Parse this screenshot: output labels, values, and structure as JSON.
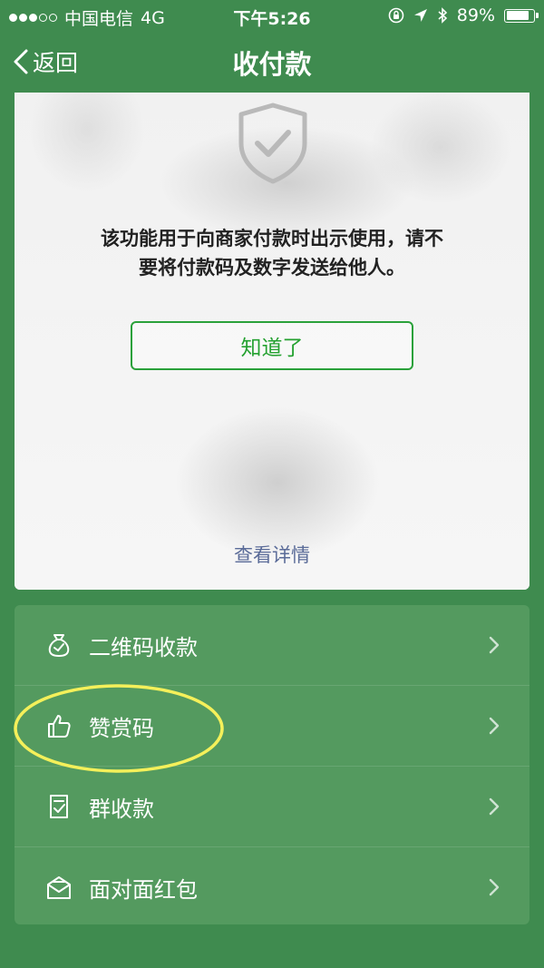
{
  "status_bar": {
    "carrier": "中国电信",
    "network": "4G",
    "time": "下午5:26",
    "battery_percent": "89%",
    "battery_level": 0.89,
    "signal_bars_filled": 3,
    "signal_bars_total": 5
  },
  "nav": {
    "back_label": "返回",
    "title": "收付款"
  },
  "notice": {
    "message_line1": "该功能用于向商家付款时出示使用，请不",
    "message_line2": "要将付款码及数字发送给他人。",
    "ok_button": "知道了",
    "details_link": "查看详情"
  },
  "menu": {
    "items": [
      {
        "label": "二维码收款",
        "icon": "money-bag-icon"
      },
      {
        "label": "赞赏码",
        "icon": "thumbs-up-icon"
      },
      {
        "label": "群收款",
        "icon": "group-payment-icon"
      },
      {
        "label": "面对面红包",
        "icon": "red-packet-icon"
      }
    ]
  },
  "colors": {
    "background": "#3f8b4f",
    "menu_background": "#549a5f",
    "accent_green": "#24a130",
    "link_blue": "#5a6b98",
    "highlight_yellow": "#f4f05a"
  }
}
